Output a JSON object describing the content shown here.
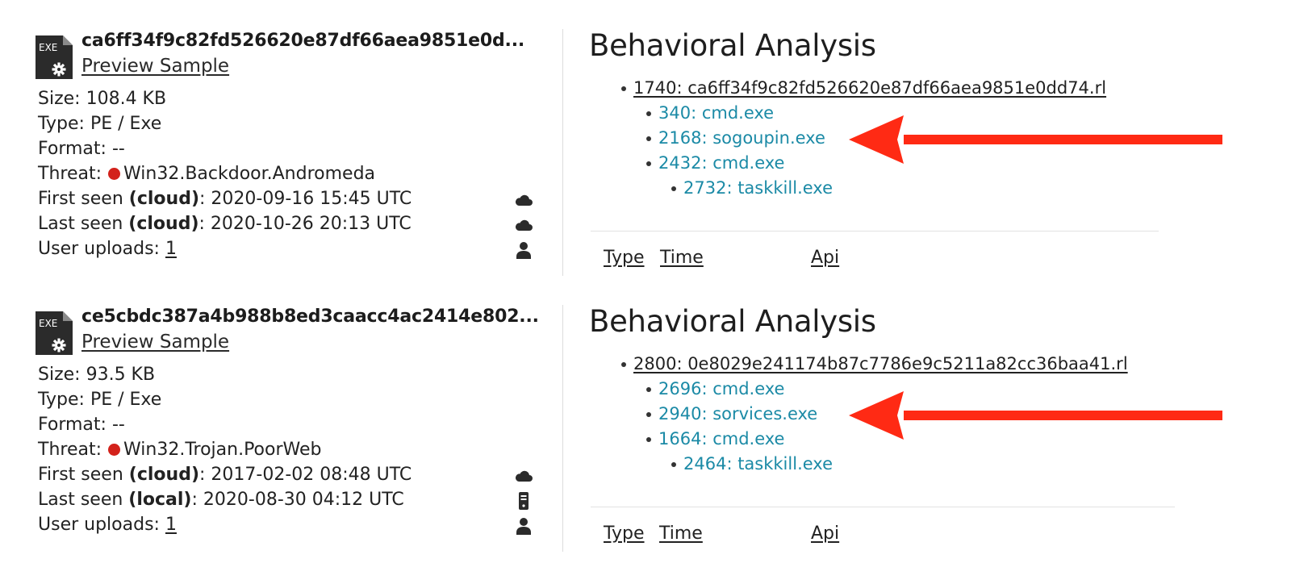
{
  "samples": [
    {
      "file_name": "ca6ff34f9c82fd526620e87df66aea9851e0d...",
      "file_type_icon": "EXE",
      "preview_label": "Preview Sample",
      "size_label": "Size:",
      "size": "108.4 KB",
      "type_label": "Type:",
      "type": "PE / Exe",
      "format_label": "Format:",
      "format": "--",
      "threat_label": "Threat:",
      "threat": "Win32.Backdoor.Andromeda",
      "first_seen_label": "First seen",
      "first_seen_src": "(cloud)",
      "first_seen": "2020-09-16 15:45 UTC",
      "first_seen_icon": "cloud-icon",
      "last_seen_label": "Last seen",
      "last_seen_src": "(cloud)",
      "last_seen": "2020-10-26 20:13 UTC",
      "last_seen_icon": "cloud-icon",
      "uploads_label": "User uploads:",
      "uploads": "1",
      "uploads_icon": "user-icon",
      "analysis_title": "Behavioral Analysis",
      "root_process": "1740: ca6ff34f9c82fd526620e87df66aea9851e0dd74.rl",
      "children": [
        "340: cmd.exe",
        "2168: sogoupin.exe",
        "2432: cmd.exe"
      ],
      "grandchild": "2732: taskkill.exe",
      "columns": [
        "Type",
        "Time",
        "Api"
      ]
    },
    {
      "file_name": "ce5cbdc387a4b988b8ed3caacc4ac2414e802...",
      "file_type_icon": "EXE",
      "preview_label": "Preview Sample",
      "size_label": "Size:",
      "size": "93.5 KB",
      "type_label": "Type:",
      "type": "PE / Exe",
      "format_label": "Format:",
      "format": "--",
      "threat_label": "Threat:",
      "threat": "Win32.Trojan.PoorWeb",
      "first_seen_label": "First seen",
      "first_seen_src": "(cloud)",
      "first_seen": "2017-02-02 08:48 UTC",
      "first_seen_icon": "cloud-icon",
      "last_seen_label": "Last seen",
      "last_seen_src": "(local)",
      "last_seen": "2020-08-30 04:12 UTC",
      "last_seen_icon": "server-icon",
      "uploads_label": "User uploads:",
      "uploads": "1",
      "uploads_icon": "user-icon",
      "analysis_title": "Behavioral Analysis",
      "root_process": "2800: 0e8029e241174b87c7786e9c5211a82cc36baa41.rl",
      "children": [
        "2696: cmd.exe",
        "2940: sorvices.exe",
        "1664: cmd.exe"
      ],
      "grandchild": "2464: taskkill.exe",
      "columns": [
        "Type",
        "Time",
        "Api"
      ]
    }
  ],
  "colors": {
    "threat_dot": "#d3221b",
    "process_link": "#1b8aa6",
    "annotation_arrow": "#ff2a14",
    "icon_dark": "#2b2b2b"
  }
}
